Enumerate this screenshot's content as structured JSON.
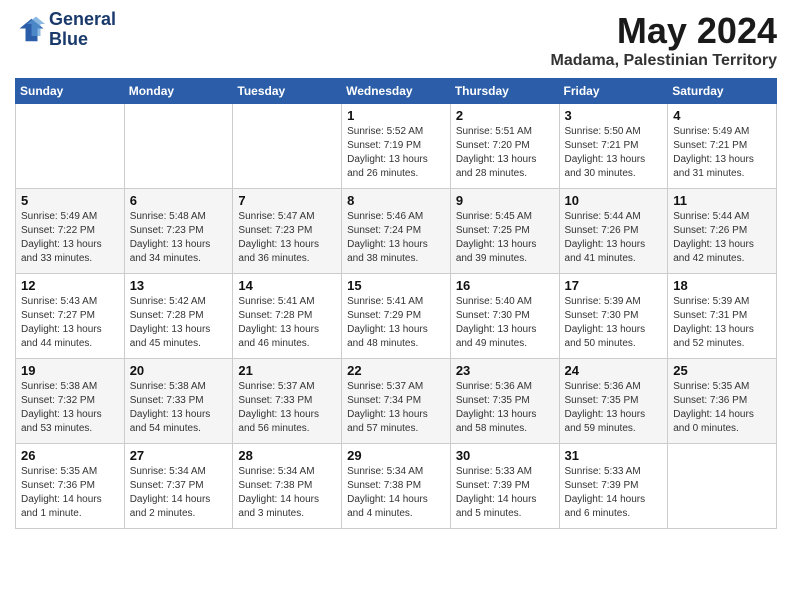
{
  "header": {
    "logo_line1": "General",
    "logo_line2": "Blue",
    "month": "May 2024",
    "location": "Madama, Palestinian Territory"
  },
  "days_of_week": [
    "Sunday",
    "Monday",
    "Tuesday",
    "Wednesday",
    "Thursday",
    "Friday",
    "Saturday"
  ],
  "weeks": [
    {
      "cells": [
        {
          "day": null,
          "content": ""
        },
        {
          "day": null,
          "content": ""
        },
        {
          "day": null,
          "content": ""
        },
        {
          "day": 1,
          "content": "Sunrise: 5:52 AM\nSunset: 7:19 PM\nDaylight: 13 hours\nand 26 minutes."
        },
        {
          "day": 2,
          "content": "Sunrise: 5:51 AM\nSunset: 7:20 PM\nDaylight: 13 hours\nand 28 minutes."
        },
        {
          "day": 3,
          "content": "Sunrise: 5:50 AM\nSunset: 7:21 PM\nDaylight: 13 hours\nand 30 minutes."
        },
        {
          "day": 4,
          "content": "Sunrise: 5:49 AM\nSunset: 7:21 PM\nDaylight: 13 hours\nand 31 minutes."
        }
      ]
    },
    {
      "cells": [
        {
          "day": 5,
          "content": "Sunrise: 5:49 AM\nSunset: 7:22 PM\nDaylight: 13 hours\nand 33 minutes."
        },
        {
          "day": 6,
          "content": "Sunrise: 5:48 AM\nSunset: 7:23 PM\nDaylight: 13 hours\nand 34 minutes."
        },
        {
          "day": 7,
          "content": "Sunrise: 5:47 AM\nSunset: 7:23 PM\nDaylight: 13 hours\nand 36 minutes."
        },
        {
          "day": 8,
          "content": "Sunrise: 5:46 AM\nSunset: 7:24 PM\nDaylight: 13 hours\nand 38 minutes."
        },
        {
          "day": 9,
          "content": "Sunrise: 5:45 AM\nSunset: 7:25 PM\nDaylight: 13 hours\nand 39 minutes."
        },
        {
          "day": 10,
          "content": "Sunrise: 5:44 AM\nSunset: 7:26 PM\nDaylight: 13 hours\nand 41 minutes."
        },
        {
          "day": 11,
          "content": "Sunrise: 5:44 AM\nSunset: 7:26 PM\nDaylight: 13 hours\nand 42 minutes."
        }
      ]
    },
    {
      "cells": [
        {
          "day": 12,
          "content": "Sunrise: 5:43 AM\nSunset: 7:27 PM\nDaylight: 13 hours\nand 44 minutes."
        },
        {
          "day": 13,
          "content": "Sunrise: 5:42 AM\nSunset: 7:28 PM\nDaylight: 13 hours\nand 45 minutes."
        },
        {
          "day": 14,
          "content": "Sunrise: 5:41 AM\nSunset: 7:28 PM\nDaylight: 13 hours\nand 46 minutes."
        },
        {
          "day": 15,
          "content": "Sunrise: 5:41 AM\nSunset: 7:29 PM\nDaylight: 13 hours\nand 48 minutes."
        },
        {
          "day": 16,
          "content": "Sunrise: 5:40 AM\nSunset: 7:30 PM\nDaylight: 13 hours\nand 49 minutes."
        },
        {
          "day": 17,
          "content": "Sunrise: 5:39 AM\nSunset: 7:30 PM\nDaylight: 13 hours\nand 50 minutes."
        },
        {
          "day": 18,
          "content": "Sunrise: 5:39 AM\nSunset: 7:31 PM\nDaylight: 13 hours\nand 52 minutes."
        }
      ]
    },
    {
      "cells": [
        {
          "day": 19,
          "content": "Sunrise: 5:38 AM\nSunset: 7:32 PM\nDaylight: 13 hours\nand 53 minutes."
        },
        {
          "day": 20,
          "content": "Sunrise: 5:38 AM\nSunset: 7:33 PM\nDaylight: 13 hours\nand 54 minutes."
        },
        {
          "day": 21,
          "content": "Sunrise: 5:37 AM\nSunset: 7:33 PM\nDaylight: 13 hours\nand 56 minutes."
        },
        {
          "day": 22,
          "content": "Sunrise: 5:37 AM\nSunset: 7:34 PM\nDaylight: 13 hours\nand 57 minutes."
        },
        {
          "day": 23,
          "content": "Sunrise: 5:36 AM\nSunset: 7:35 PM\nDaylight: 13 hours\nand 58 minutes."
        },
        {
          "day": 24,
          "content": "Sunrise: 5:36 AM\nSunset: 7:35 PM\nDaylight: 13 hours\nand 59 minutes."
        },
        {
          "day": 25,
          "content": "Sunrise: 5:35 AM\nSunset: 7:36 PM\nDaylight: 14 hours\nand 0 minutes."
        }
      ]
    },
    {
      "cells": [
        {
          "day": 26,
          "content": "Sunrise: 5:35 AM\nSunset: 7:36 PM\nDaylight: 14 hours\nand 1 minute."
        },
        {
          "day": 27,
          "content": "Sunrise: 5:34 AM\nSunset: 7:37 PM\nDaylight: 14 hours\nand 2 minutes."
        },
        {
          "day": 28,
          "content": "Sunrise: 5:34 AM\nSunset: 7:38 PM\nDaylight: 14 hours\nand 3 minutes."
        },
        {
          "day": 29,
          "content": "Sunrise: 5:34 AM\nSunset: 7:38 PM\nDaylight: 14 hours\nand 4 minutes."
        },
        {
          "day": 30,
          "content": "Sunrise: 5:33 AM\nSunset: 7:39 PM\nDaylight: 14 hours\nand 5 minutes."
        },
        {
          "day": 31,
          "content": "Sunrise: 5:33 AM\nSunset: 7:39 PM\nDaylight: 14 hours\nand 6 minutes."
        },
        {
          "day": null,
          "content": ""
        }
      ]
    }
  ]
}
